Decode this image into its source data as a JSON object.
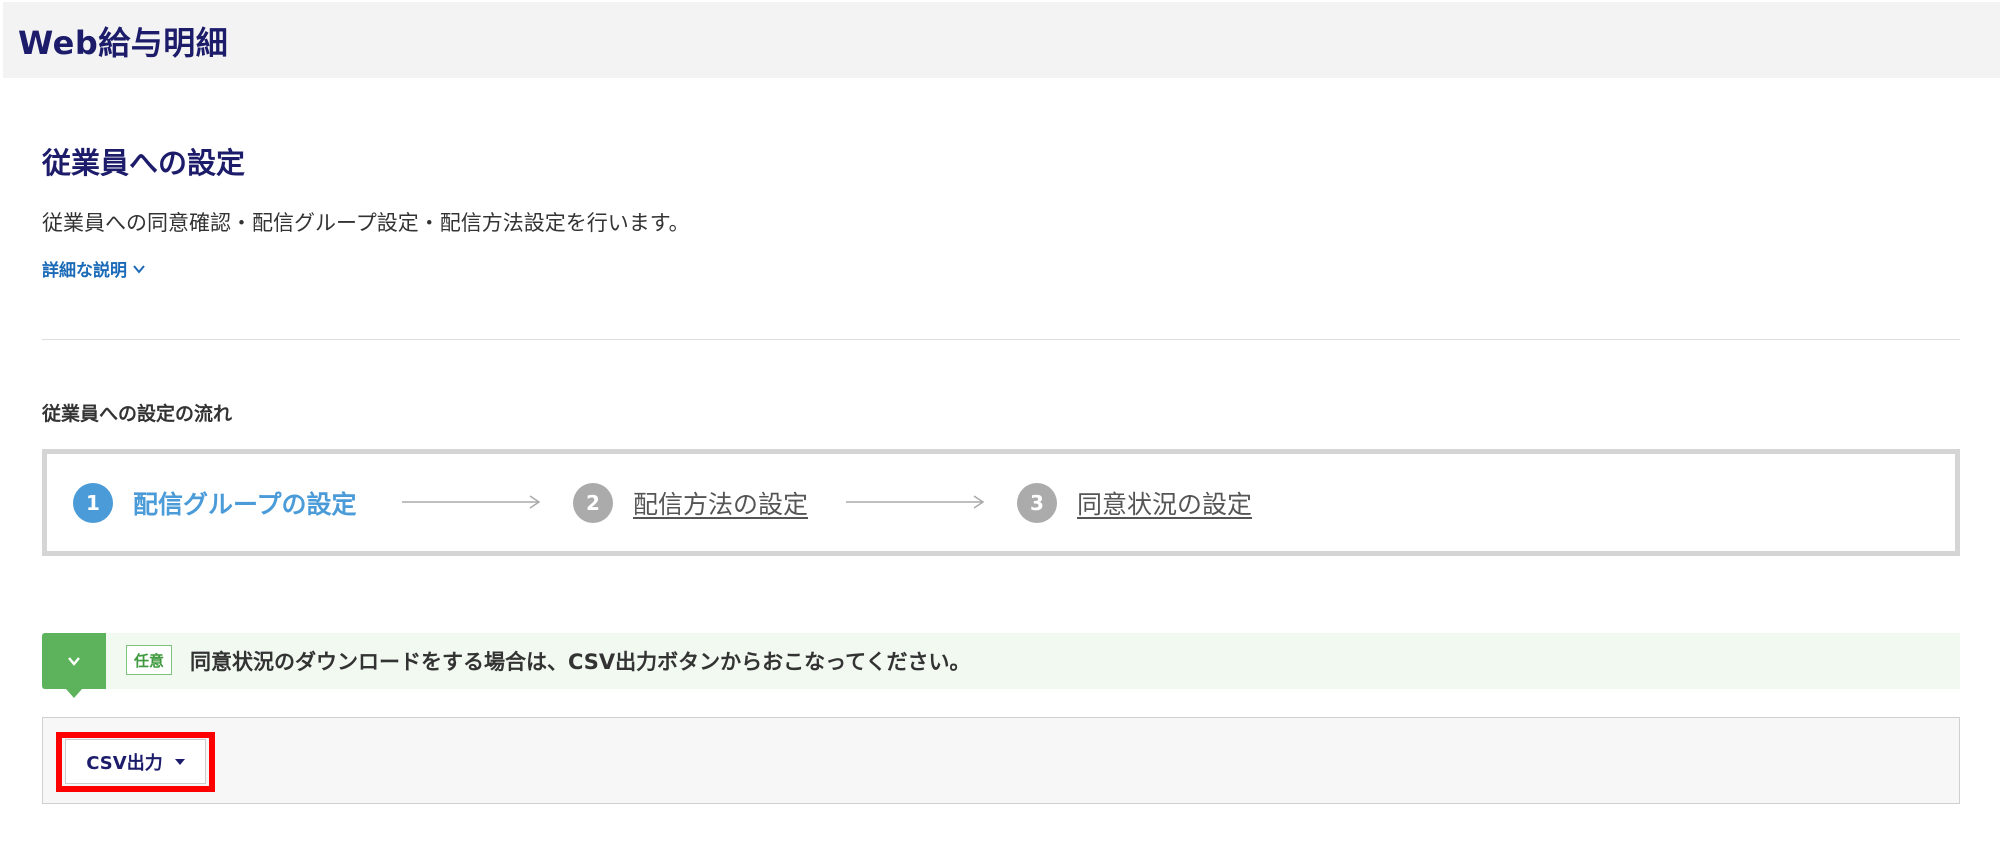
{
  "header": {
    "title": "Web給与明細"
  },
  "page": {
    "title": "従業員への設定",
    "description": "従業員への同意確認・配信グループ設定・配信方法設定を行います。",
    "detail_link": "詳細な説明"
  },
  "flow": {
    "title": "従業員への設定の流れ",
    "steps": [
      {
        "number": "1",
        "label": "配信グループの設定",
        "state": "active"
      },
      {
        "number": "2",
        "label": "配信方法の設定",
        "state": "inactive"
      },
      {
        "number": "3",
        "label": "同意状況の設定",
        "state": "inactive"
      }
    ]
  },
  "notice": {
    "badge": "任意",
    "text": "同意状況のダウンロードをする場合は、CSV出力ボタンからおこなってください。"
  },
  "actions": {
    "csv_button": "CSV出力"
  },
  "colors": {
    "brand_navy": "#1c1c6b",
    "link_blue": "#1a6ab8",
    "active_step": "#4a9bd8",
    "inactive_step": "#ababab",
    "notice_green": "#5cb35c",
    "highlight_red": "#ff0000"
  },
  "icons": {
    "detail_toggle": "chevron-down-icon",
    "step_connector": "arrow-right-icon",
    "notice_toggle": "chevron-down-icon",
    "dropdown": "caret-down-icon"
  }
}
